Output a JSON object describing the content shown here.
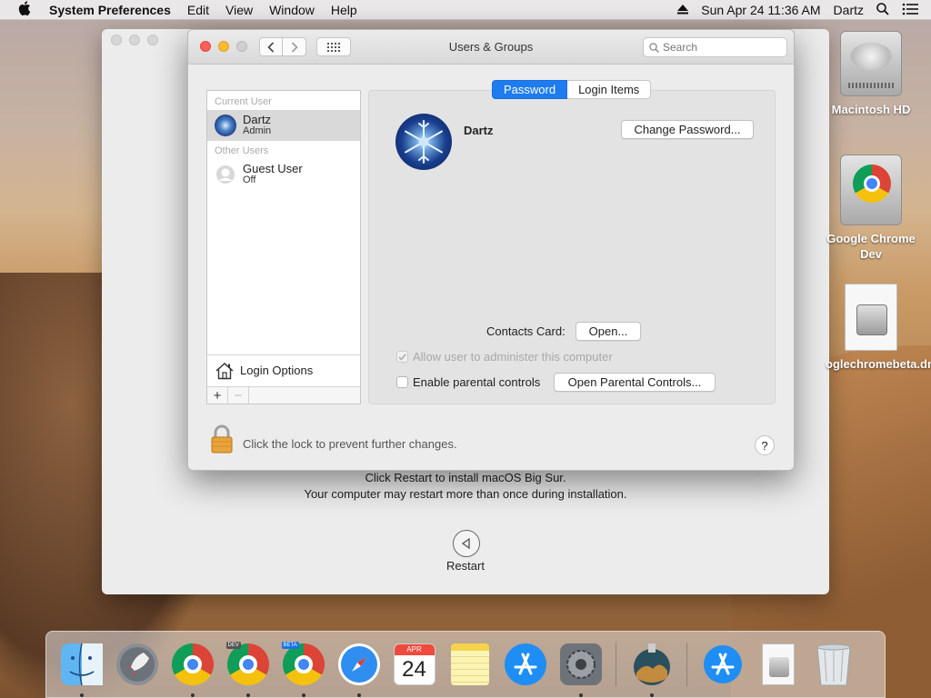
{
  "menubar": {
    "app_name": "System Preferences",
    "items": [
      "Edit",
      "View",
      "Window",
      "Help"
    ],
    "datetime": "Sun Apr 24  11:36 AM",
    "user": "Dartz"
  },
  "install_window": {
    "line1": "Click Restart to install macOS Big Sur.",
    "line2": "Your computer may restart more than once during installation.",
    "restart_label": "Restart"
  },
  "prefs": {
    "title": "Users & Groups",
    "search_placeholder": "Search",
    "current_user_label": "Current User",
    "other_users_label": "Other Users",
    "users": [
      {
        "name": "Dartz",
        "role": "Admin"
      },
      {
        "name": "Guest User",
        "role": "Off"
      }
    ],
    "login_options": "Login Options",
    "tabs": {
      "password": "Password",
      "login_items": "Login Items"
    },
    "selected_user_name": "Dartz",
    "change_password": "Change Password...",
    "contacts_card_label": "Contacts Card:",
    "open_button": "Open...",
    "allow_admin_label": "Allow user to administer this computer",
    "parental_label": "Enable parental controls",
    "open_parental_button": "Open Parental Controls...",
    "lock_text": "Click the lock to prevent further changes.",
    "help": "?"
  },
  "desktop": {
    "icons": [
      {
        "label": "Macintosh HD"
      },
      {
        "label": "Google Chrome Dev"
      },
      {
        "label": "oglechromebeta.dmg"
      }
    ]
  },
  "dock": {
    "items": [
      "Finder",
      "Launchpad",
      "Google Chrome",
      "Google Chrome Dev",
      "Google Chrome Beta",
      "Safari",
      "Calendar",
      "Notes",
      "App Store",
      "System Preferences",
      "Install macOS Big Sur",
      "App Store Downloads",
      "Disk Image",
      "Trash"
    ],
    "calendar_month": "APR",
    "calendar_day": "24",
    "dev_badge": "DEV",
    "beta_badge": "BETA"
  }
}
